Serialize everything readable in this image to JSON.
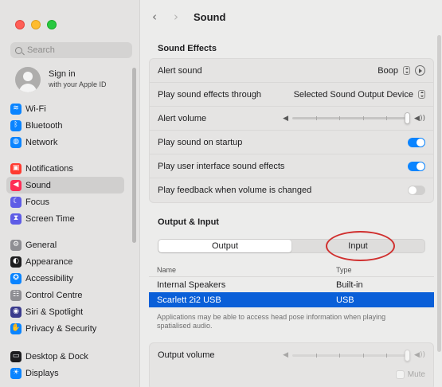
{
  "window": {
    "title": "Sound"
  },
  "sidebar": {
    "search_placeholder": "Search",
    "account": {
      "line1": "Sign in",
      "line2": "with your Apple ID"
    },
    "groups": [
      [
        {
          "label": "Wi-Fi",
          "icon": "wifi-icon",
          "color": "#0a84ff",
          "glyph": "≋"
        },
        {
          "label": "Bluetooth",
          "icon": "bluetooth-icon",
          "color": "#0a84ff",
          "glyph": "ᛒ"
        },
        {
          "label": "Network",
          "icon": "globe-icon",
          "color": "#0a84ff",
          "glyph": "◍"
        }
      ],
      [
        {
          "label": "Notifications",
          "icon": "bell-icon",
          "color": "#ff3b30",
          "glyph": "▣"
        },
        {
          "label": "Sound",
          "icon": "speaker-icon",
          "color": "#ff2d55",
          "glyph": "◀",
          "selected": true
        },
        {
          "label": "Focus",
          "icon": "moon-icon",
          "color": "#5e5ce6",
          "glyph": "☾"
        },
        {
          "label": "Screen Time",
          "icon": "hourglass-icon",
          "color": "#5e5ce6",
          "glyph": "⧗"
        }
      ],
      [
        {
          "label": "General",
          "icon": "gear-icon",
          "color": "#8e8e93",
          "glyph": "⚙"
        },
        {
          "label": "Appearance",
          "icon": "appearance-icon",
          "color": "#1d1d1f",
          "glyph": "◐"
        },
        {
          "label": "Accessibility",
          "icon": "accessibility-icon",
          "color": "#0a84ff",
          "glyph": "✪"
        },
        {
          "label": "Control Centre",
          "icon": "control-centre-icon",
          "color": "#8e8e93",
          "glyph": "☷"
        },
        {
          "label": "Siri & Spotlight",
          "icon": "siri-icon",
          "color": "#3a3a8c",
          "glyph": "◉"
        },
        {
          "label": "Privacy & Security",
          "icon": "hand-icon",
          "color": "#0a84ff",
          "glyph": "✋"
        }
      ],
      [
        {
          "label": "Desktop & Dock",
          "icon": "dock-icon",
          "color": "#1d1d1f",
          "glyph": "▭"
        },
        {
          "label": "Displays",
          "icon": "displays-icon",
          "color": "#0a84ff",
          "glyph": "☀"
        }
      ]
    ]
  },
  "main": {
    "back_glyph": "‹",
    "forward_glyph": "›",
    "sound_effects": {
      "header": "Sound Effects",
      "alert_sound_label": "Alert sound",
      "alert_sound_value": "Boop",
      "play_through_label": "Play sound effects through",
      "play_through_value": "Selected Sound Output Device",
      "alert_volume_label": "Alert volume",
      "alert_volume_level": 1.0,
      "startup_label": "Play sound on startup",
      "startup_on": true,
      "ui_sounds_label": "Play user interface sound effects",
      "ui_sounds_on": true,
      "feedback_label": "Play feedback when volume is changed",
      "feedback_on": false
    },
    "output_input": {
      "header": "Output & Input",
      "tabs": [
        "Output",
        "Input"
      ],
      "active_tab": "Output",
      "columns": [
        "Name",
        "Type"
      ],
      "devices": [
        {
          "name": "Internal Speakers",
          "type": "Built-in",
          "selected": false
        },
        {
          "name": "Scarlett 2i2 USB",
          "type": "USB",
          "selected": true
        }
      ],
      "note": "Applications may be able to access head pose information when playing spatialised audio."
    },
    "output_volume": {
      "label": "Output volume",
      "level": 1.0,
      "mute_label": "Mute"
    }
  },
  "colors": {
    "accent": "#0a84ff",
    "selection": "#0a5fd8",
    "annotation": "#d0302f"
  }
}
